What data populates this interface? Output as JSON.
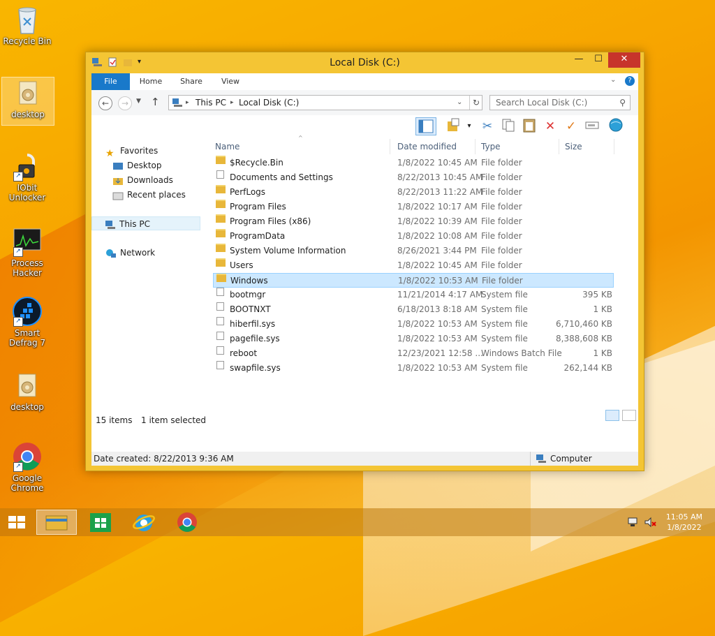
{
  "desktop": {
    "icons": [
      {
        "label": "Recycle Bin"
      },
      {
        "label": "desktop"
      },
      {
        "label": "IObit Unlocker"
      },
      {
        "label": "Process Hacker"
      },
      {
        "label": "Smart Defrag 7"
      },
      {
        "label": "desktop"
      },
      {
        "label": "Google Chrome"
      }
    ]
  },
  "window": {
    "title": "Local Disk (C:)",
    "controls": {
      "minimize": "—",
      "maximize": "☐",
      "close": "✕"
    },
    "ribbon_tabs": [
      "File",
      "Home",
      "Share",
      "View"
    ],
    "address": {
      "segments": [
        "This PC",
        "Local Disk (C:)"
      ]
    },
    "search_placeholder": "Search Local Disk (C:)",
    "nav": {
      "favorites": "Favorites",
      "favorites_items": [
        "Desktop",
        "Downloads",
        "Recent places"
      ],
      "this_pc": "This PC",
      "network": "Network"
    },
    "columns": {
      "name": "Name",
      "date": "Date modified",
      "type": "Type",
      "size": "Size"
    },
    "files": [
      {
        "name": "$Recycle.Bin",
        "date": "1/8/2022 10:45 AM",
        "type": "File folder",
        "size": "",
        "kind": "folder"
      },
      {
        "name": "Documents and Settings",
        "date": "8/22/2013 10:45 AM",
        "type": "File folder",
        "size": "",
        "kind": "link"
      },
      {
        "name": "PerfLogs",
        "date": "8/22/2013 11:22 AM",
        "type": "File folder",
        "size": "",
        "kind": "folder"
      },
      {
        "name": "Program Files",
        "date": "1/8/2022 10:17 AM",
        "type": "File folder",
        "size": "",
        "kind": "folder"
      },
      {
        "name": "Program Files (x86)",
        "date": "1/8/2022 10:39 AM",
        "type": "File folder",
        "size": "",
        "kind": "folder"
      },
      {
        "name": "ProgramData",
        "date": "1/8/2022 10:08 AM",
        "type": "File folder",
        "size": "",
        "kind": "folder"
      },
      {
        "name": "System Volume Information",
        "date": "8/26/2021 3:44 PM",
        "type": "File folder",
        "size": "",
        "kind": "folder"
      },
      {
        "name": "Users",
        "date": "1/8/2022 10:45 AM",
        "type": "File folder",
        "size": "",
        "kind": "folder"
      },
      {
        "name": "Windows",
        "date": "1/8/2022 10:53 AM",
        "type": "File folder",
        "size": "",
        "kind": "folder",
        "selected": true
      },
      {
        "name": "bootmgr",
        "date": "11/21/2014 4:17 AM",
        "type": "System file",
        "size": "395 KB",
        "kind": "file"
      },
      {
        "name": "BOOTNXT",
        "date": "6/18/2013 8:18 AM",
        "type": "System file",
        "size": "1 KB",
        "kind": "file"
      },
      {
        "name": "hiberfil.sys",
        "date": "1/8/2022 10:53 AM",
        "type": "System file",
        "size": "6,710,460 KB",
        "kind": "file"
      },
      {
        "name": "pagefile.sys",
        "date": "1/8/2022 10:53 AM",
        "type": "System file",
        "size": "8,388,608 KB",
        "kind": "file"
      },
      {
        "name": "reboot",
        "date": "12/23/2021 12:58 ...",
        "type": "Windows Batch File",
        "size": "1 KB",
        "kind": "batch"
      },
      {
        "name": "swapfile.sys",
        "date": "1/8/2022 10:53 AM",
        "type": "System file",
        "size": "262,144 KB",
        "kind": "file"
      }
    ],
    "status": {
      "items": "15 items",
      "selected": "1 item selected"
    },
    "details": {
      "created": "Date created: 8/22/2013 9:36 AM",
      "location": "Computer"
    }
  },
  "taskbar": {
    "time": "11:05 AM",
    "date": "1/8/2022"
  },
  "colors": {
    "accent": "#1979ca",
    "selection": "#cce8ff",
    "window_frame": "#f4c534"
  }
}
